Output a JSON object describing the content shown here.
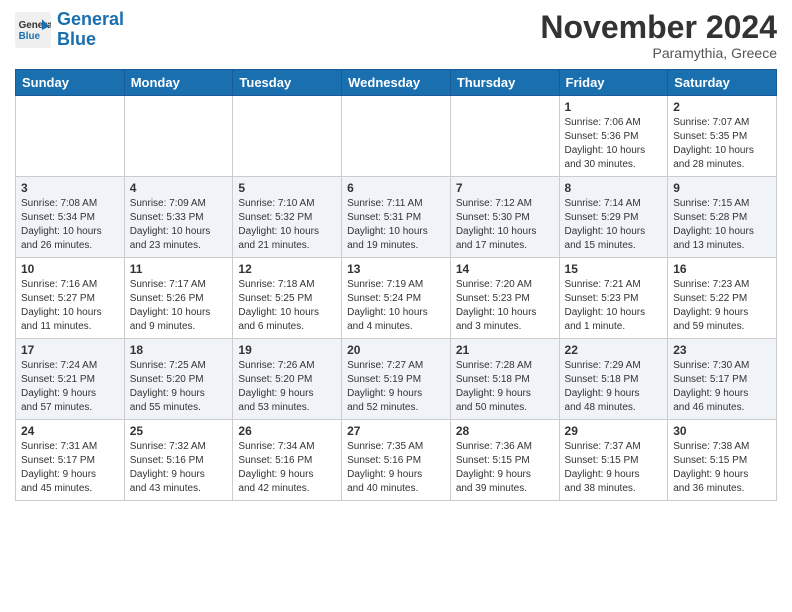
{
  "header": {
    "logo_line1": "General",
    "logo_line2": "Blue",
    "month": "November 2024",
    "location": "Paramythia, Greece"
  },
  "weekdays": [
    "Sunday",
    "Monday",
    "Tuesday",
    "Wednesday",
    "Thursday",
    "Friday",
    "Saturday"
  ],
  "weeks": [
    [
      {
        "day": "",
        "info": ""
      },
      {
        "day": "",
        "info": ""
      },
      {
        "day": "",
        "info": ""
      },
      {
        "day": "",
        "info": ""
      },
      {
        "day": "",
        "info": ""
      },
      {
        "day": "1",
        "info": "Sunrise: 7:06 AM\nSunset: 5:36 PM\nDaylight: 10 hours\nand 30 minutes."
      },
      {
        "day": "2",
        "info": "Sunrise: 7:07 AM\nSunset: 5:35 PM\nDaylight: 10 hours\nand 28 minutes."
      }
    ],
    [
      {
        "day": "3",
        "info": "Sunrise: 7:08 AM\nSunset: 5:34 PM\nDaylight: 10 hours\nand 26 minutes."
      },
      {
        "day": "4",
        "info": "Sunrise: 7:09 AM\nSunset: 5:33 PM\nDaylight: 10 hours\nand 23 minutes."
      },
      {
        "day": "5",
        "info": "Sunrise: 7:10 AM\nSunset: 5:32 PM\nDaylight: 10 hours\nand 21 minutes."
      },
      {
        "day": "6",
        "info": "Sunrise: 7:11 AM\nSunset: 5:31 PM\nDaylight: 10 hours\nand 19 minutes."
      },
      {
        "day": "7",
        "info": "Sunrise: 7:12 AM\nSunset: 5:30 PM\nDaylight: 10 hours\nand 17 minutes."
      },
      {
        "day": "8",
        "info": "Sunrise: 7:14 AM\nSunset: 5:29 PM\nDaylight: 10 hours\nand 15 minutes."
      },
      {
        "day": "9",
        "info": "Sunrise: 7:15 AM\nSunset: 5:28 PM\nDaylight: 10 hours\nand 13 minutes."
      }
    ],
    [
      {
        "day": "10",
        "info": "Sunrise: 7:16 AM\nSunset: 5:27 PM\nDaylight: 10 hours\nand 11 minutes."
      },
      {
        "day": "11",
        "info": "Sunrise: 7:17 AM\nSunset: 5:26 PM\nDaylight: 10 hours\nand 9 minutes."
      },
      {
        "day": "12",
        "info": "Sunrise: 7:18 AM\nSunset: 5:25 PM\nDaylight: 10 hours\nand 6 minutes."
      },
      {
        "day": "13",
        "info": "Sunrise: 7:19 AM\nSunset: 5:24 PM\nDaylight: 10 hours\nand 4 minutes."
      },
      {
        "day": "14",
        "info": "Sunrise: 7:20 AM\nSunset: 5:23 PM\nDaylight: 10 hours\nand 3 minutes."
      },
      {
        "day": "15",
        "info": "Sunrise: 7:21 AM\nSunset: 5:23 PM\nDaylight: 10 hours\nand 1 minute."
      },
      {
        "day": "16",
        "info": "Sunrise: 7:23 AM\nSunset: 5:22 PM\nDaylight: 9 hours\nand 59 minutes."
      }
    ],
    [
      {
        "day": "17",
        "info": "Sunrise: 7:24 AM\nSunset: 5:21 PM\nDaylight: 9 hours\nand 57 minutes."
      },
      {
        "day": "18",
        "info": "Sunrise: 7:25 AM\nSunset: 5:20 PM\nDaylight: 9 hours\nand 55 minutes."
      },
      {
        "day": "19",
        "info": "Sunrise: 7:26 AM\nSunset: 5:20 PM\nDaylight: 9 hours\nand 53 minutes."
      },
      {
        "day": "20",
        "info": "Sunrise: 7:27 AM\nSunset: 5:19 PM\nDaylight: 9 hours\nand 52 minutes."
      },
      {
        "day": "21",
        "info": "Sunrise: 7:28 AM\nSunset: 5:18 PM\nDaylight: 9 hours\nand 50 minutes."
      },
      {
        "day": "22",
        "info": "Sunrise: 7:29 AM\nSunset: 5:18 PM\nDaylight: 9 hours\nand 48 minutes."
      },
      {
        "day": "23",
        "info": "Sunrise: 7:30 AM\nSunset: 5:17 PM\nDaylight: 9 hours\nand 46 minutes."
      }
    ],
    [
      {
        "day": "24",
        "info": "Sunrise: 7:31 AM\nSunset: 5:17 PM\nDaylight: 9 hours\nand 45 minutes."
      },
      {
        "day": "25",
        "info": "Sunrise: 7:32 AM\nSunset: 5:16 PM\nDaylight: 9 hours\nand 43 minutes."
      },
      {
        "day": "26",
        "info": "Sunrise: 7:34 AM\nSunset: 5:16 PM\nDaylight: 9 hours\nand 42 minutes."
      },
      {
        "day": "27",
        "info": "Sunrise: 7:35 AM\nSunset: 5:16 PM\nDaylight: 9 hours\nand 40 minutes."
      },
      {
        "day": "28",
        "info": "Sunrise: 7:36 AM\nSunset: 5:15 PM\nDaylight: 9 hours\nand 39 minutes."
      },
      {
        "day": "29",
        "info": "Sunrise: 7:37 AM\nSunset: 5:15 PM\nDaylight: 9 hours\nand 38 minutes."
      },
      {
        "day": "30",
        "info": "Sunrise: 7:38 AM\nSunset: 5:15 PM\nDaylight: 9 hours\nand 36 minutes."
      }
    ]
  ]
}
